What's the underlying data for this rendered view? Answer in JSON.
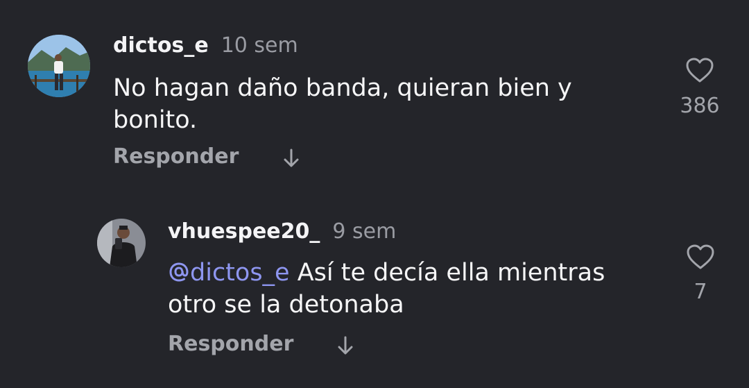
{
  "comments": [
    {
      "username": "dictos_e",
      "time": "10 sem",
      "text": "No hagan daño banda, quieran bien y bonito.",
      "reply_label": "Responder",
      "likes": "386"
    },
    {
      "username": "vhuespee20_",
      "time": "9 sem",
      "mention": "dictos_e",
      "text": "Así te decía ella mientras otro se la detonaba",
      "reply_label": "Responder",
      "likes": "7"
    }
  ],
  "icons": {
    "like": "heart-icon",
    "replies": "arrow-down-icon",
    "mention": "threads-at-icon"
  },
  "colors": {
    "background": "#24252a",
    "mention": "#8e96f0",
    "muted": "#9a9ca3"
  }
}
